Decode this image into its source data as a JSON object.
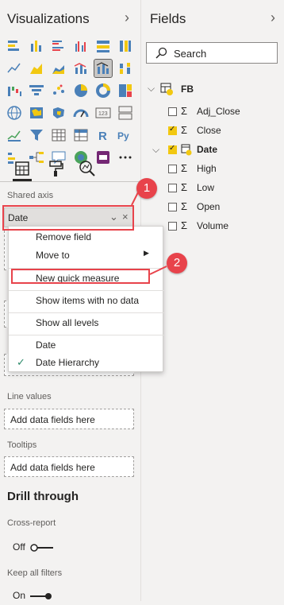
{
  "visualizations": {
    "title": "Visualizations",
    "collapse_icon": "chevron-right-icon"
  },
  "fields_pane": {
    "title": "Fields",
    "collapse_icon": "chevron-right-icon",
    "search_placeholder": "Search"
  },
  "shared_axis": {
    "label": "Shared axis",
    "field": "Date"
  },
  "context_menu": {
    "items": [
      "Remove field",
      "Move to",
      "New quick measure",
      "Show items with no data",
      "Show all levels",
      "Date",
      "Date Hierarchy"
    ],
    "checked_item": "Date Hierarchy"
  },
  "wells": {
    "line_values_label": "Line values",
    "line_values_placeholder": "Add data fields here",
    "tooltips_label": "Tooltips",
    "tooltips_placeholder": "Add data fields here"
  },
  "drill_through": {
    "title": "Drill through",
    "cross_report_label": "Cross-report",
    "cross_report_state": "Off",
    "keep_filters_label": "Keep all filters",
    "keep_filters_state": "On"
  },
  "table": {
    "name": "FB",
    "fields": [
      {
        "name": "Adj_Close",
        "checked": false,
        "type": "sigma"
      },
      {
        "name": "Close",
        "checked": true,
        "type": "sigma"
      },
      {
        "name": "Date",
        "checked": true,
        "type": "date"
      },
      {
        "name": "High",
        "checked": false,
        "type": "sigma"
      },
      {
        "name": "Low",
        "checked": false,
        "type": "sigma"
      },
      {
        "name": "Open",
        "checked": false,
        "type": "sigma"
      },
      {
        "name": "Volume",
        "checked": false,
        "type": "sigma"
      }
    ]
  },
  "annotations": {
    "callout_1": "1",
    "callout_2": "2",
    "color": "#e8434b"
  },
  "colors": {
    "accent_yellow": "#f2c811",
    "panel_bg": "#f3f2f1"
  }
}
